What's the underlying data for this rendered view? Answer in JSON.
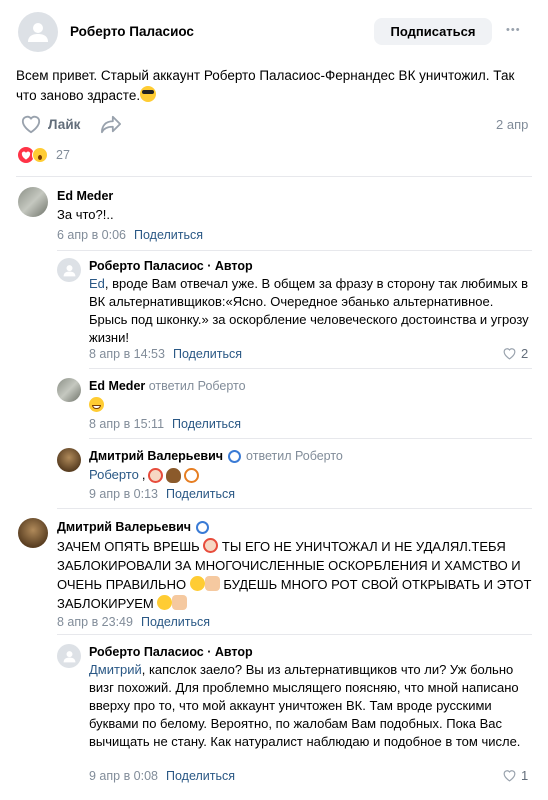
{
  "post": {
    "author": "Роберто Паласиос",
    "subscribe_label": "Подписаться",
    "more_label": "•••",
    "text": "Всем привет. Старый аккаунт Роберто Паласиос-Фернандес ВК уничтожил. Так что заново здрасте.",
    "like_label": "Лайк",
    "date": "2 апр",
    "reactions_count": "27"
  },
  "comments": [
    {
      "author": "Ed Meder",
      "text": "За что?!..",
      "date": "6 апр в 0:06",
      "share": "Поделиться"
    },
    {
      "author": "Роберто Паласиос · Автор",
      "mention": "Ed",
      "text": ", вроде Вам отвечал уже. В общем за фразу в сторону так любимых в ВК альтернативщиков:«Ясно. Очередное эбанько альтернативное. Брысь под шконку.» за оскорбление человеческого достоинства и угрозу жизни!",
      "date": "8 апр в 14:53",
      "share": "Поделиться",
      "likes": "2"
    },
    {
      "author": "Ed Meder",
      "reply_to": "ответил Роберто",
      "date": "8 апр в 15:11",
      "share": "Поделиться"
    },
    {
      "author": "Дмитрий Валерьевич",
      "reply_to": "ответил Роберто",
      "mention": "Роберто",
      "date": "9 апр в 0:13",
      "share": "Поделиться"
    },
    {
      "author": "Дмитрий Валерьевич",
      "text_1": "ЗАЧЕМ ОПЯТЬ ВРЕШЬ",
      "text_2": "ТЫ ЕГО НЕ УНИЧТОЖАЛ И НЕ УДАЛЯЛ.ТЕБЯ",
      "text_3": "ЗАБЛОКИРОВАЛИ ЗА МНОГОЧИСЛЕННЫЕ ОСКОРБЛЕНИЯ И ХАМСТВО И",
      "text_4": "ОЧЕНЬ ПРАВИЛЬНО",
      "text_5": "БУДЕШЬ МНОГО РОТ СВОЙ ОТКРЫВАТЬ И ЭТОТ",
      "text_6": "ЗАБЛОКИРУЕМ",
      "date": "8 апр в 23:49",
      "share": "Поделиться"
    },
    {
      "author": "Роберто Паласиос · Автор",
      "mention": "Дмитрий",
      "text": ", капслок заело? Вы из альтернативщиков что ли? Уж больно визг похожий. Для проблемно мыслящего поясняю, что мной написано вверху про то, что мой аккаунт уничтожен ВК. Там вроде русскими буквами по белому. Вероятно, по жалобам Вам подобных. Пока Вас вычищать не стану. Как натуралист наблюдаю и подобное в том числе.",
      "date": "9 апр в 0:08",
      "share": "Поделиться",
      "likes": "1"
    }
  ],
  "colors": {
    "link": "#2a5885",
    "meta": "#818c99",
    "like_red": "#ff3347",
    "button_bg": "#f0f2f5"
  }
}
